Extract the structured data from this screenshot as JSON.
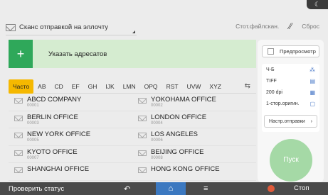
{
  "header": {
    "destination_line": "Сканс отправкой на эллочту",
    "stored_file_label": "Стот.файлскан.",
    "reset_label": "Сброс"
  },
  "add_destination": {
    "plus": "+",
    "label": "Указать адресатов"
  },
  "tabs": [
    "Часто",
    "AB",
    "CD",
    "EF",
    "GH",
    "IJK",
    "LMN",
    "OPQ",
    "RST",
    "UVW",
    "XYZ"
  ],
  "active_tab": "Часто",
  "sort_icon": "sort-icon",
  "destinations": [
    {
      "name": "ABCD COMPANY",
      "num": "00001"
    },
    {
      "name": "YOKOHAMA OFFICE",
      "num": "00002"
    },
    {
      "name": "BERLIN OFFICE",
      "num": "00003"
    },
    {
      "name": "LONDON OFFICE",
      "num": "00004"
    },
    {
      "name": "NEW YORK OFFICE",
      "num": "00005"
    },
    {
      "name": "LOS ANGELES",
      "num": "00006"
    },
    {
      "name": "KYOTO OFFICE",
      "num": "00007"
    },
    {
      "name": "BEIJING OFFICE",
      "num": "00008"
    },
    {
      "name": "SHANGHAI OFFICE",
      "num": ""
    },
    {
      "name": "HONG KONG OFFICE",
      "num": ""
    }
  ],
  "side": {
    "preview_label": "Предпросмотр",
    "settings": [
      {
        "value": "Ч-Б",
        "icon": "color-mode-icon"
      },
      {
        "value": "TIFF",
        "icon": "file-type-icon"
      },
      {
        "value": "200 dpi",
        "icon": "resolution-icon"
      },
      {
        "value": "1-стор.оригин.",
        "icon": "original-sides-icon"
      }
    ],
    "send_settings_label": "Настр.отправки",
    "start_label": "Пуск"
  },
  "bottom": {
    "check_status": "Проверить статус",
    "stop": "Стоп"
  }
}
